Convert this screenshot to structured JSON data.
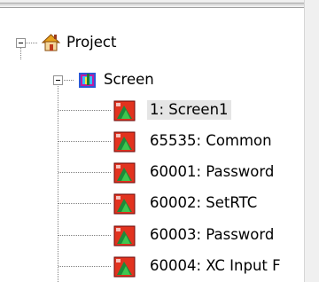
{
  "tree": {
    "root": {
      "label": "Project",
      "icon": "house-icon"
    },
    "folder": {
      "label": "Screen",
      "icon": "screen-folder-icon"
    },
    "items": [
      {
        "label": "1: Screen1",
        "selected": true
      },
      {
        "label": "65535: Common"
      },
      {
        "label": "60001: Password"
      },
      {
        "label": "60002: SetRTC"
      },
      {
        "label": "60003: Password"
      },
      {
        "label": "60004: XC Input F"
      }
    ]
  },
  "colors": {
    "selection": "#e5e5e5",
    "screen_item_green": "#1c8b3a",
    "screen_item_red": "#e2331f",
    "folder_blue": "#2b58d8",
    "folder_magenta": "#c01aa0"
  }
}
